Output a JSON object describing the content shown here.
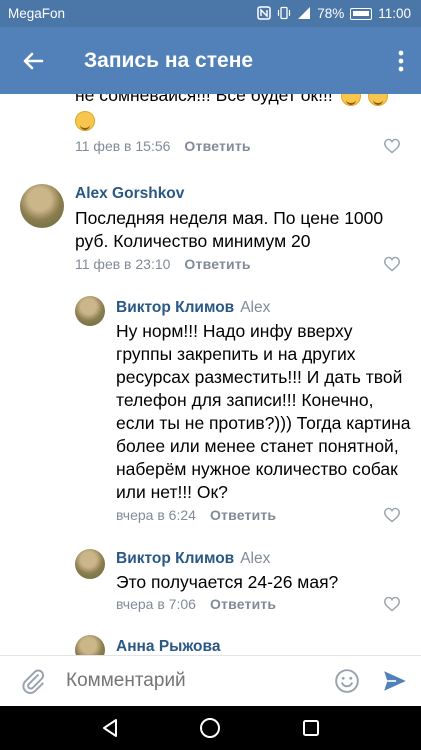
{
  "status_bar": {
    "carrier": "MegaFon",
    "battery": "78%",
    "time": "11:00"
  },
  "app_bar": {
    "title": "Запись на стене"
  },
  "feed": {
    "cut_comment": {
      "text": "не сомневайся!!! Всё будет ок!!!",
      "time": "11 фев в 15:56",
      "reply": "Ответить"
    },
    "comments": [
      {
        "author": "Alex Gorshkov",
        "to": "",
        "text": "Последняя неделя мая. По цене 1000 руб. Количество минимум 20",
        "time": "11 фев в 23:10",
        "reply": "Ответить"
      },
      {
        "author": "Виктор Климов",
        "to": "Alex",
        "text": "Ну норм!!! Надо инфу вверху группы закрепить и на других ресурсах разместить!!! И дать твой телефон для записи!!! Конечно, если ты не против?))) Тогда картина более или менее станет понятной, наберём нужное количество собак или нет!!! Ок?",
        "time": "вчера в 6:24",
        "reply": "Ответить"
      },
      {
        "author": "Виктор Климов",
        "to": "Alex",
        "text": "Это получается 24-26 мая?",
        "time": "вчера в 7:06",
        "reply": "Ответить"
      },
      {
        "author": "Анна Рыжова",
        "to": "",
        "text": "",
        "time": "",
        "reply": ""
      }
    ]
  },
  "composer": {
    "placeholder": "Комментарий"
  },
  "colors": {
    "status_bar": "#4a76a8",
    "app_bar": "#5181b8",
    "link": "#2a5885",
    "muted": "#828a99",
    "send": "#5181b8"
  }
}
